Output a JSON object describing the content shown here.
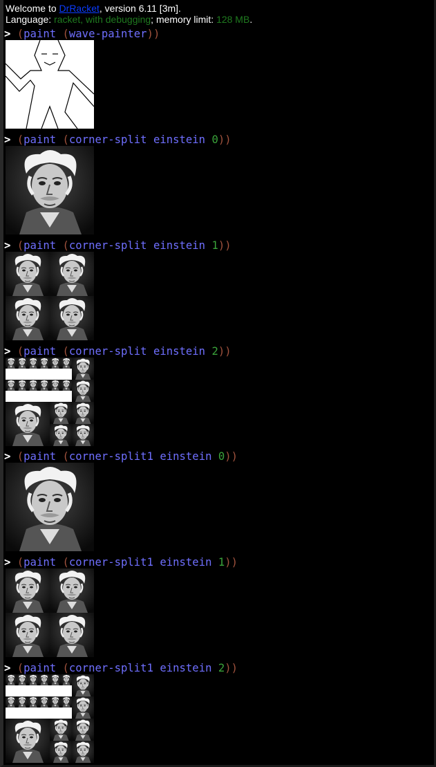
{
  "banner": {
    "welcome_prefix": "Welcome to ",
    "app_link": "DrRacket",
    "welcome_suffix": ", version 6.11 [3m].",
    "language_prefix": "Language: ",
    "language_value": "racket, with debugging",
    "memory_prefix": "; memory limit: ",
    "memory_value": "128 MB",
    "memory_suffix": "."
  },
  "prompt": ">",
  "interactions": [
    {
      "fn": "paint",
      "inner": "wave-painter",
      "arg": "",
      "n": "",
      "image": "wave"
    },
    {
      "fn": "paint",
      "inner": "corner-split",
      "arg": "einstein",
      "n": "0",
      "image": "einstein"
    },
    {
      "fn": "paint",
      "inner": "corner-split",
      "arg": "einstein",
      "n": "1",
      "image": "einstein"
    },
    {
      "fn": "paint",
      "inner": "corner-split",
      "arg": "einstein",
      "n": "2",
      "image": "einstein"
    },
    {
      "fn": "paint",
      "inner": "corner-split1",
      "arg": "einstein",
      "n": "0",
      "image": "einstein"
    },
    {
      "fn": "paint",
      "inner": "corner-split1",
      "arg": "einstein",
      "n": "1",
      "image": "einstein"
    },
    {
      "fn": "paint",
      "inner": "corner-split1",
      "arg": "einstein",
      "n": "2",
      "image": "einstein"
    }
  ],
  "colors": {
    "background": "#000000",
    "link": "#0b3cff",
    "language_green": "#1f7a1f",
    "paren": "#a0523d",
    "symbol": "#6f6fff",
    "number": "#3aa33a"
  }
}
